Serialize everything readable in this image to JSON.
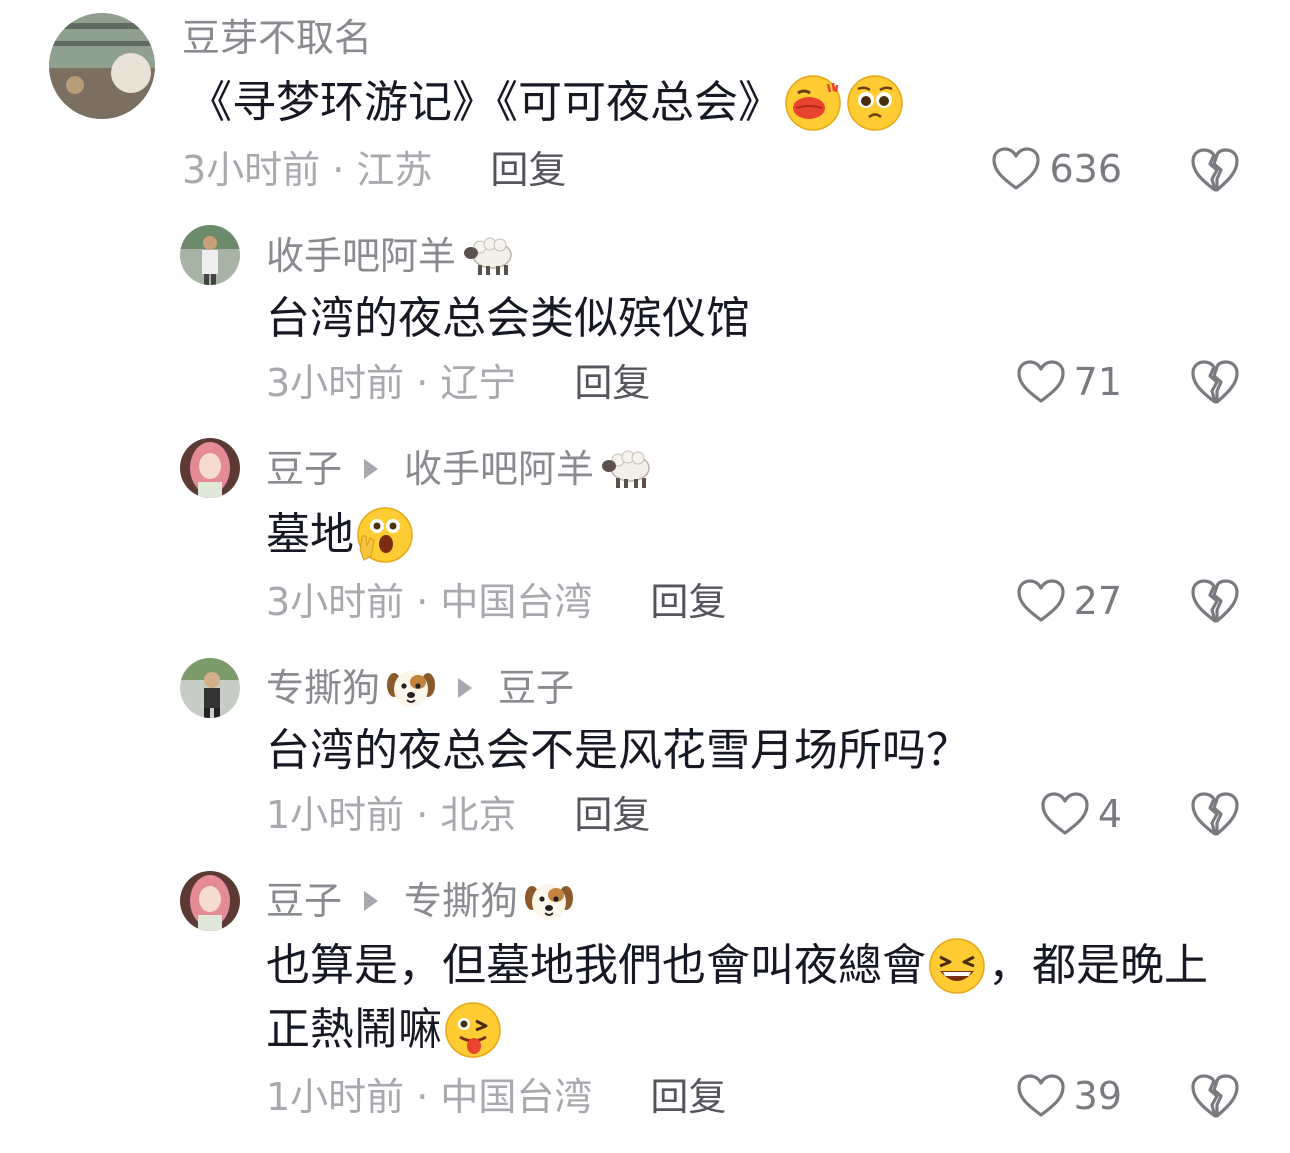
{
  "comments": [
    {
      "author": "豆芽不取名",
      "text_a": "《寻梦环游记》《可可夜总会》",
      "time": "3小时前 · 江苏",
      "reply": "回复",
      "likes": "636",
      "emojis": [
        "kiss-emoji",
        "pleading-emoji"
      ]
    },
    {
      "author": "收手吧阿羊",
      "author_emoji": "sheep-emoji",
      "text_a": "台湾的夜总会类似殡仪馆",
      "time": "3小时前 · 辽宁",
      "reply": "回复",
      "likes": "71"
    },
    {
      "author": "豆子",
      "reply_to": "收手吧阿羊",
      "reply_to_emoji": "sheep-emoji",
      "text_a": "墓地",
      "emojis": [
        "shocked-emoji"
      ],
      "time": "3小时前 · 中国台湾",
      "reply": "回复",
      "likes": "27"
    },
    {
      "author": "专撕狗",
      "author_emoji": "dog-emoji",
      "reply_to": "豆子",
      "text_a": "台湾的夜总会不是风花雪月场所吗？",
      "time": "1小时前 · 北京",
      "reply": "回复",
      "likes": "4"
    },
    {
      "author": "豆子",
      "reply_to": "专撕狗",
      "reply_to_emoji": "dog-emoji",
      "text_a": "也算是，但墓地我們也會叫夜總會",
      "text_b": "，都是晚上",
      "text_c": "正熱鬧嘛",
      "emojis": [
        "laughing-emoji",
        "wink-tongue-emoji"
      ],
      "time": "1小时前 · 中国台湾",
      "reply": "回复",
      "likes": "39"
    }
  ],
  "colors": {
    "name": "#8a8b91",
    "meta": "#a8a9ae",
    "reply": "#55565c",
    "text": "#161823"
  }
}
